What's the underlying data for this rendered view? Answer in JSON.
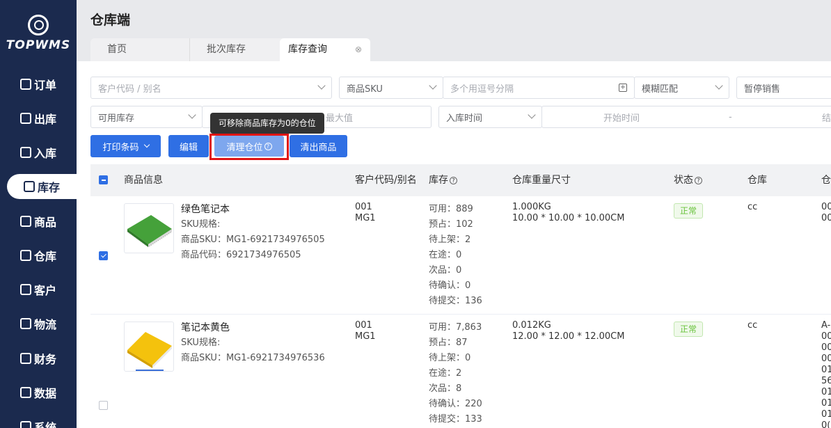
{
  "sidebar": {
    "logo_text": "TOPWMS",
    "items": [
      {
        "label": "订单",
        "icon": "order-icon"
      },
      {
        "label": "出库",
        "icon": "outbound-icon"
      },
      {
        "label": "入库",
        "icon": "inbound-icon"
      },
      {
        "label": "库存",
        "icon": "inventory-icon"
      },
      {
        "label": "商品",
        "icon": "product-icon"
      },
      {
        "label": "仓库",
        "icon": "warehouse-icon"
      },
      {
        "label": "客户",
        "icon": "customer-icon"
      },
      {
        "label": "物流",
        "icon": "logistics-icon"
      },
      {
        "label": "财务",
        "icon": "finance-icon"
      },
      {
        "label": "数据",
        "icon": "data-icon"
      },
      {
        "label": "系统",
        "icon": "system-icon"
      }
    ],
    "active_index": 3
  },
  "header": {
    "title": "仓库端",
    "tabs": [
      {
        "label": "首页"
      },
      {
        "label": "批次库存"
      },
      {
        "label": "库存查询",
        "close": "⊗"
      }
    ]
  },
  "filters": {
    "customer_placeholder": "客户代码 / 别名",
    "sku_type": "商品SKU",
    "sku_placeholder": "多个用逗号分隔",
    "match_mode": "模糊匹配",
    "sale_status": "暂停销售",
    "stock_type": "可用库存",
    "max_placeholder": "最大值",
    "time_type": "入库时间",
    "start_placeholder": "开始时间",
    "range_sep": "-",
    "end_placeholder": "结"
  },
  "toolbar": {
    "print_label": "打印条码",
    "edit_label": "编辑",
    "clear_location_label": "清理仓位",
    "clear_goods_label": "清出商品",
    "tooltip": "可移除商品库存为0的仓位"
  },
  "table": {
    "columns": [
      "商品信息",
      "客户代码/别名",
      "库存",
      "仓库重量尺寸",
      "状态",
      "仓库",
      "仓"
    ],
    "rows": [
      {
        "checked": true,
        "name": "绿色笔记本",
        "spec": "SKU规格:",
        "sku": "商品SKU：MG1-6921734976505",
        "code": "商品代码：6921734976505",
        "customer": [
          "001",
          "MG1"
        ],
        "stock": [
          "可用：889",
          "预占：102",
          "待上架：2",
          "在途：0",
          "次品：0",
          "待确认：0",
          "待提交：136"
        ],
        "weight": "1.000KG",
        "size": "10.00 * 10.00 * 10.00CM",
        "status": "正常",
        "warehouse": "cc",
        "location": [
          "00",
          "00"
        ]
      },
      {
        "checked": false,
        "name": "笔记本黄色",
        "spec": "SKU规格:",
        "sku": "商品SKU：MG1-6921734976536",
        "code": "",
        "customer": [
          "001",
          "MG1"
        ],
        "stock": [
          "可用：7,863",
          "预占：87",
          "待上架：0",
          "在途：2",
          "次品：8",
          "待确认：220",
          "待提交：133"
        ],
        "weight": "0.012KG",
        "size": "12.00 * 12.00 * 12.00CM",
        "status": "正常",
        "warehouse": "cc",
        "location": [
          "A-",
          "00",
          "00",
          "00",
          "01",
          "56",
          "01",
          "01",
          "01",
          "0("
        ]
      }
    ]
  },
  "colors": {
    "sidebar_bg": "#1b2a4e",
    "primary": "#2f6fe4",
    "highlight": "#e01515",
    "status_ok": "#67c23a"
  }
}
